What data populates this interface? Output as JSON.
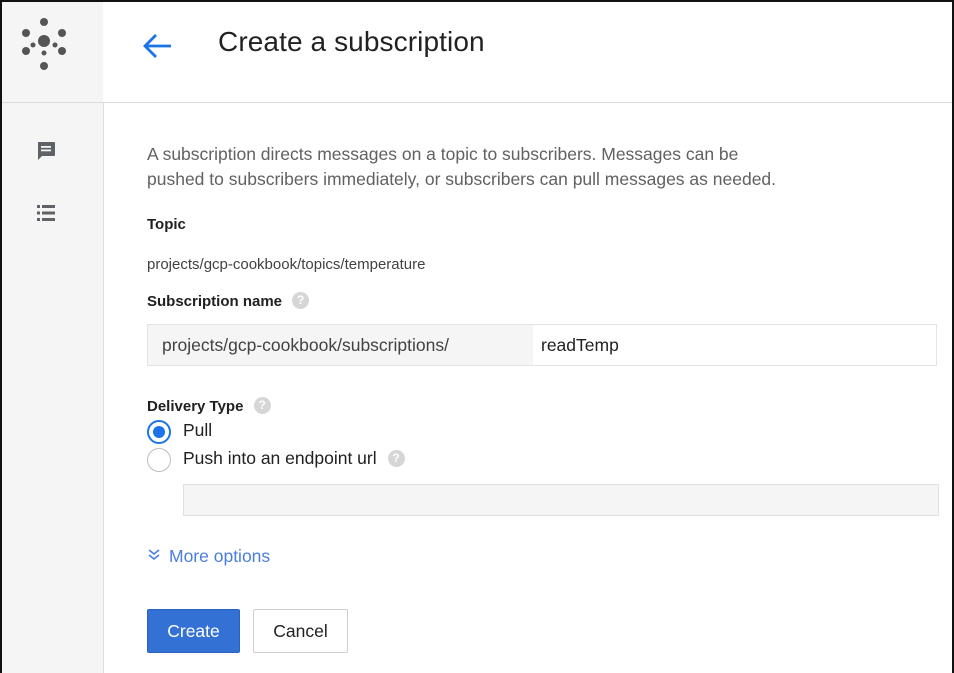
{
  "header": {
    "title": "Create a subscription"
  },
  "intro": {
    "line1": "A subscription directs messages on a topic to subscribers. Messages can be",
    "line2": "pushed to subscribers immediately, or subscribers can pull messages as needed."
  },
  "topic": {
    "label": "Topic",
    "value": "projects/gcp-cookbook/topics/temperature"
  },
  "subscription": {
    "label": "Subscription name",
    "prefix": "projects/gcp-cookbook/subscriptions/",
    "value": "readTemp"
  },
  "delivery": {
    "label": "Delivery Type",
    "options": [
      {
        "label": "Pull",
        "selected": true
      },
      {
        "label": "Push into an endpoint url",
        "selected": false
      }
    ],
    "endpoint_value": ""
  },
  "more_options": {
    "label": "More options"
  },
  "buttons": {
    "create": "Create",
    "cancel": "Cancel"
  },
  "icons": {
    "logo": "pubsub-logo-icon",
    "back": "arrow-back-icon",
    "rail_1": "message-icon",
    "rail_2": "list-icon",
    "help": "help-icon",
    "expand": "double-chevron-down-icon"
  },
  "colors": {
    "accent": "#1a73e8",
    "primary_button": "#3372d4",
    "link": "#4a7ede",
    "rail_bg": "#f5f5f5"
  }
}
